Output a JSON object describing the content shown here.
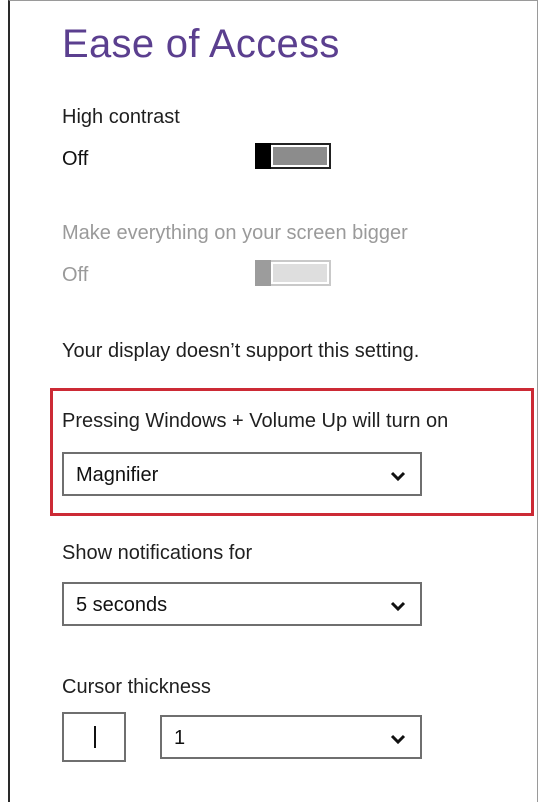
{
  "page": {
    "title": "Ease of Access"
  },
  "high_contrast": {
    "label": "High contrast",
    "state": "Off"
  },
  "bigger": {
    "label": "Make everything on your screen bigger",
    "state": "Off",
    "note": "Your display doesn’t support this setting."
  },
  "win_volume": {
    "label": "Pressing Windows + Volume Up will turn on",
    "selected": "Magnifier"
  },
  "notifications": {
    "label": "Show notifications for",
    "selected": "5 seconds"
  },
  "cursor": {
    "label": "Cursor thickness",
    "selected": "1"
  },
  "colors": {
    "title": "#5b3f8f",
    "highlight": "#cc2a35"
  }
}
